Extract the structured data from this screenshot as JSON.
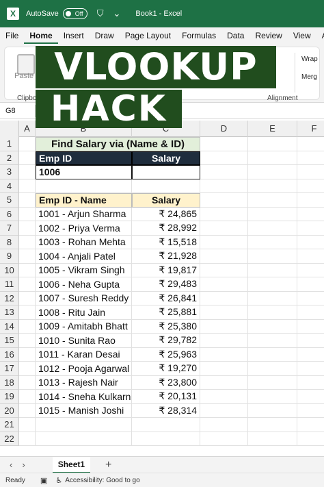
{
  "titlebar": {
    "autosave_label": "AutoSave",
    "toggle_state": "Off",
    "title": "Book1  -  Excel"
  },
  "ribbon_tabs": [
    "File",
    "Home",
    "Insert",
    "Draw",
    "Page Layout",
    "Formulas",
    "Data",
    "Review",
    "View",
    "Aut"
  ],
  "ribbon": {
    "paste_label": "Paste",
    "clipboard_label": "Clipboa",
    "alignment_label": "Alignment",
    "wrap_label": "Wrap",
    "merge_label": "Merg"
  },
  "formula_bar": {
    "name_box": "G8",
    "fx_label": "fx"
  },
  "banner": {
    "line1": "VLOOKUP",
    "line2": "HACK"
  },
  "columns": [
    "A",
    "B",
    "C",
    "D",
    "E",
    "F"
  ],
  "rows": [
    "1",
    "2",
    "3",
    "4",
    "5",
    "6",
    "7",
    "8",
    "9",
    "10",
    "11",
    "12",
    "13",
    "14",
    "15",
    "16",
    "17",
    "18",
    "19",
    "20",
    "21",
    "22"
  ],
  "sheet": {
    "title": "Find Salary via (Name & ID)",
    "lookup_header_id": "Emp ID",
    "lookup_header_salary": "Salary",
    "lookup_id_value": "1006",
    "lookup_salary_value": "",
    "table_header_name": "Emp ID - Name",
    "table_header_salary": "Salary",
    "employees": [
      {
        "name": "1001 - Arjun Sharma",
        "salary": "₹ 24,865"
      },
      {
        "name": "1002 - Priya Verma",
        "salary": "₹ 28,992"
      },
      {
        "name": "1003 - Rohan Mehta",
        "salary": "₹ 15,518"
      },
      {
        "name": "1004 - Anjali Patel",
        "salary": "₹ 21,928"
      },
      {
        "name": "1005 - Vikram Singh",
        "salary": "₹ 19,817"
      },
      {
        "name": "1006 - Neha Gupta",
        "salary": "₹ 29,483"
      },
      {
        "name": "1007 - Suresh Reddy",
        "salary": "₹ 26,841"
      },
      {
        "name": "1008 - Ritu Jain",
        "salary": "₹ 25,881"
      },
      {
        "name": "1009 - Amitabh Bhatt",
        "salary": "₹ 25,380"
      },
      {
        "name": "1010 - Sunita Rao",
        "salary": "₹ 29,782"
      },
      {
        "name": "1011 - Karan Desai",
        "salary": "₹ 25,963"
      },
      {
        "name": "1012 - Pooja Agarwal",
        "salary": "₹ 19,270"
      },
      {
        "name": "1013 - Rajesh Nair",
        "salary": "₹ 23,800"
      },
      {
        "name": "1014 - Sneha Kulkarni",
        "salary": "₹ 20,131"
      },
      {
        "name": "1015 - Manish Joshi",
        "salary": "₹ 28,314"
      }
    ]
  },
  "sheet_tabs": {
    "active": "Sheet1",
    "add_label": "+"
  },
  "status": {
    "ready": "Ready",
    "accessibility": "Accessibility: Good to go"
  },
  "colors": {
    "excel_green": "#1e7145",
    "banner_green": "#214d1e",
    "title_fill": "#e2efda",
    "navy_header": "#1f2d3d",
    "yellow_header": "#fff2cc"
  }
}
